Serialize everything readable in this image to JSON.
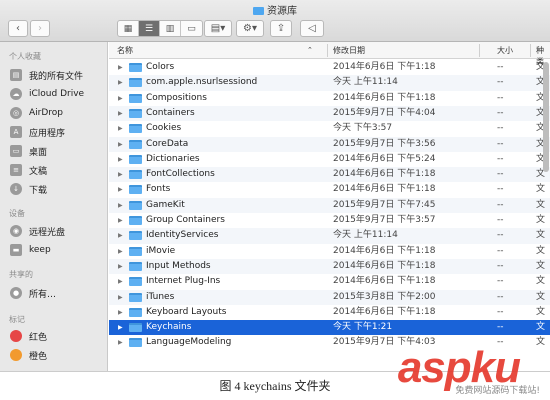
{
  "window": {
    "title": "资源库",
    "toolbar": {
      "back_icon": "chevron-left-icon",
      "forward_icon": "chevron-right-icon",
      "view_modes": [
        "icon-view",
        "list-view",
        "column-view",
        "gallery-view"
      ],
      "active_view": "list-view",
      "group_icon": "grid-group-icon",
      "action_icon": "gear-icon",
      "share_icon": "share-icon",
      "tag_icon": "tag-icon"
    }
  },
  "sidebar": {
    "sections": [
      {
        "label": "个人收藏",
        "items": [
          {
            "label": "我的所有文件",
            "icon": "all-files-icon"
          },
          {
            "label": "iCloud Drive",
            "icon": "cloud-icon"
          },
          {
            "label": "AirDrop",
            "icon": "airdrop-icon"
          },
          {
            "label": "应用程序",
            "icon": "applications-icon"
          },
          {
            "label": "桌面",
            "icon": "desktop-icon"
          },
          {
            "label": "文稿",
            "icon": "documents-icon"
          },
          {
            "label": "下载",
            "icon": "downloads-icon"
          }
        ]
      },
      {
        "label": "设备",
        "items": [
          {
            "label": "远程光盘",
            "icon": "disc-icon"
          },
          {
            "label": "keep",
            "icon": "drive-icon"
          }
        ]
      },
      {
        "label": "共享的",
        "items": [
          {
            "label": "所有…",
            "icon": "network-icon"
          }
        ]
      },
      {
        "label": "标记",
        "items": [
          {
            "label": "红色",
            "icon": "red-tag-icon",
            "color": "#e64646"
          },
          {
            "label": "橙色",
            "icon": "orange-tag-icon",
            "color": "#f29a2e"
          }
        ]
      }
    ]
  },
  "columns": {
    "name": "名称",
    "date": "修改日期",
    "size": "大小",
    "kind": "种类"
  },
  "rows": [
    {
      "name": "Colors",
      "date": "2014年6月6日 下午1:18",
      "size": "--",
      "kind": "文"
    },
    {
      "name": "com.apple.nsurlsessiond",
      "date": "今天 上午11:14",
      "size": "--",
      "kind": "文"
    },
    {
      "name": "Compositions",
      "date": "2014年6月6日 下午1:18",
      "size": "--",
      "kind": "文"
    },
    {
      "name": "Containers",
      "date": "2015年9月7日 下午4:04",
      "size": "--",
      "kind": "文"
    },
    {
      "name": "Cookies",
      "date": "今天 下午3:57",
      "size": "--",
      "kind": "文"
    },
    {
      "name": "CoreData",
      "date": "2015年9月7日 下午3:56",
      "size": "--",
      "kind": "文"
    },
    {
      "name": "Dictionaries",
      "date": "2014年6月6日 下午5:24",
      "size": "--",
      "kind": "文"
    },
    {
      "name": "FontCollections",
      "date": "2014年6月6日 下午1:18",
      "size": "--",
      "kind": "文"
    },
    {
      "name": "Fonts",
      "date": "2014年6月6日 下午1:18",
      "size": "--",
      "kind": "文"
    },
    {
      "name": "GameKit",
      "date": "2015年9月7日 下午7:45",
      "size": "--",
      "kind": "文"
    },
    {
      "name": "Group Containers",
      "date": "2015年9月7日 下午3:57",
      "size": "--",
      "kind": "文"
    },
    {
      "name": "IdentityServices",
      "date": "今天 上午11:14",
      "size": "--",
      "kind": "文"
    },
    {
      "name": "iMovie",
      "date": "2014年6月6日 下午1:18",
      "size": "--",
      "kind": "文"
    },
    {
      "name": "Input Methods",
      "date": "2014年6月6日 下午1:18",
      "size": "--",
      "kind": "文"
    },
    {
      "name": "Internet Plug-Ins",
      "date": "2014年6月6日 下午1:18",
      "size": "--",
      "kind": "文"
    },
    {
      "name": "iTunes",
      "date": "2015年3月8日 下午2:00",
      "size": "--",
      "kind": "文"
    },
    {
      "name": "Keyboard Layouts",
      "date": "2014年6月6日 下午1:18",
      "size": "--",
      "kind": "文"
    },
    {
      "name": "Keychains",
      "date": "今天 下午1:21",
      "size": "--",
      "kind": "文",
      "selected": true
    },
    {
      "name": "LanguageModeling",
      "date": "2015年9月7日 下午4:03",
      "size": "--",
      "kind": "文"
    }
  ],
  "caption": "图 4 keychains 文件夹",
  "watermark": {
    "text": "aspku",
    "sub": "免费网站源码下载站!",
    "color": "#e63a2e"
  }
}
